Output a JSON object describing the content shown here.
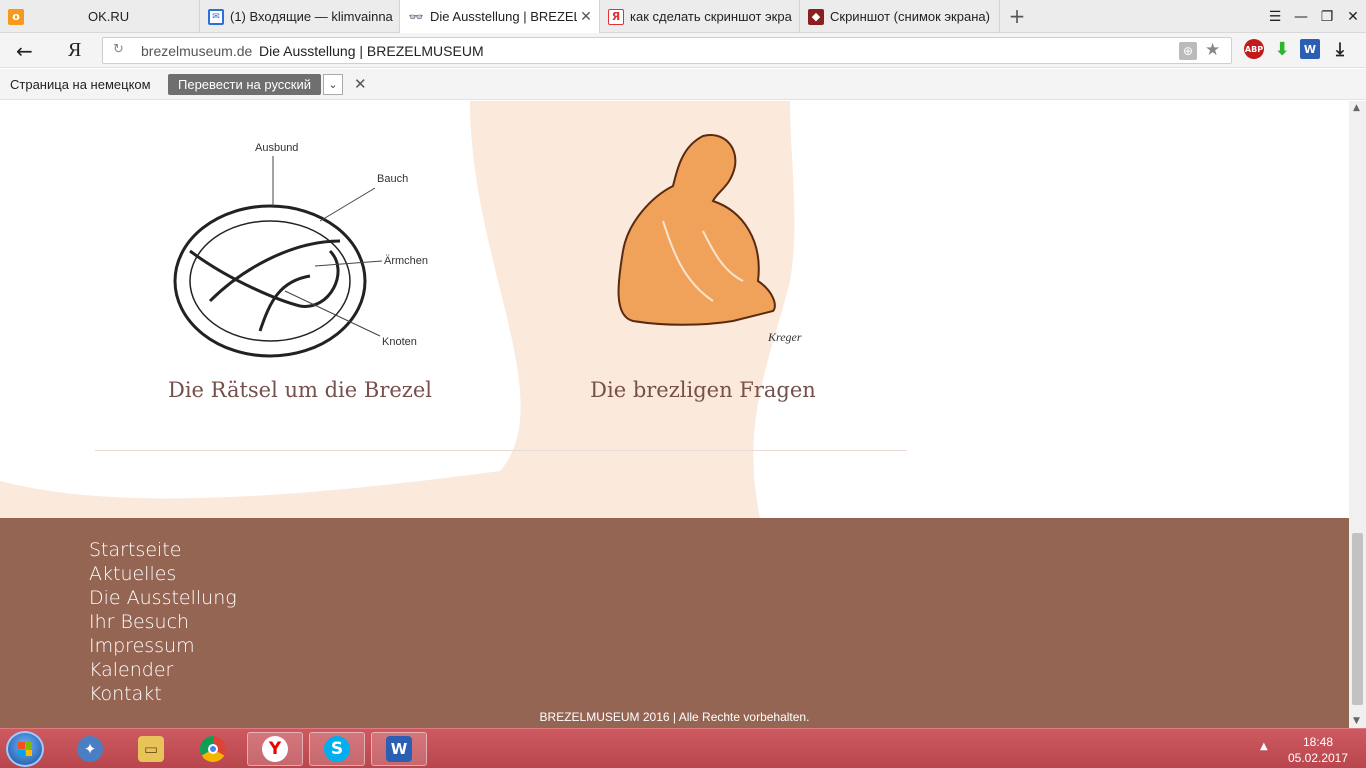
{
  "tabs": [
    {
      "title": "OK.RU",
      "favicon": "ok-icon",
      "active": false
    },
    {
      "title": "(1) Входящие — klimvainna",
      "favicon": "mail-icon",
      "active": false
    },
    {
      "title": "Die Ausstellung | BREZELM",
      "favicon": "glasses-icon",
      "active": true
    },
    {
      "title": "как сделать скриншот экра",
      "favicon": "yandex-icon",
      "active": false
    },
    {
      "title": "Скриншот (снимок экрана)",
      "favicon": "site-icon",
      "active": false
    }
  ],
  "address": {
    "host": "brezelmuseum.de",
    "page_title": "Die Ausstellung | BREZELMUSEUM",
    "logo": "Я"
  },
  "extensions": {
    "abp": "ABP"
  },
  "translate_bar": {
    "label": "Страница на немецком",
    "button": "Перевести на русский"
  },
  "cards": [
    {
      "title": "Die Rätsel um die Brezel",
      "labels": [
        "Ausbund",
        "Bauch",
        "Ärmchen",
        "Knoten"
      ]
    },
    {
      "title": "Die brezligen Fragen",
      "signature": "Kreger"
    }
  ],
  "footer": {
    "nav": [
      "Startseite",
      "Aktuelles",
      "Die Ausstellung",
      "Ihr Besuch",
      "Impressum",
      "Kalender",
      "Kontakt"
    ],
    "copyright": "BREZELMUSEUM 2016 | Alle Rechte vorbehalten."
  },
  "taskbar": {
    "apps": [
      "windows-explorer-icon",
      "file-explorer-icon",
      "chrome-icon",
      "yandex-browser-icon",
      "skype-icon",
      "word-icon"
    ],
    "time": "18:48",
    "date": "05.02.2017"
  },
  "colors": {
    "footer_bg": "#956554",
    "taskbar": "#c14f55",
    "card_title": "#76504a",
    "bg_shape": "#fbe9db"
  }
}
